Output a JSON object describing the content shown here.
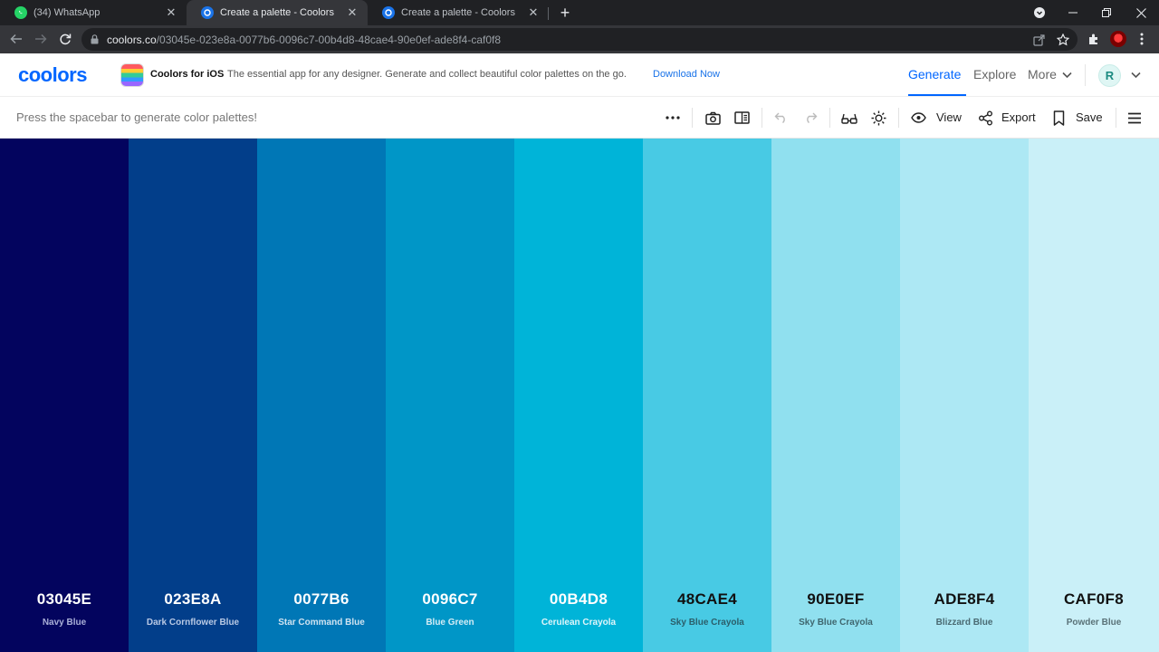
{
  "browser": {
    "tabs": [
      {
        "title": "(34) WhatsApp",
        "active": false
      },
      {
        "title": "Create a palette - Coolors",
        "active": true
      },
      {
        "title": "Create a palette - Coolors",
        "active": false
      }
    ],
    "url_host": "coolors.co",
    "url_path": "/03045e-023e8a-0077b6-0096c7-00b4d8-48cae4-90e0ef-ade8f4-caf0f8"
  },
  "header": {
    "logo": "coolors",
    "ios_title": "Coolors for iOS",
    "ios_description": "The essential app for any designer. Generate and collect beautiful color palettes on the go.",
    "ios_download": "Download Now",
    "nav": {
      "generate": "Generate",
      "explore": "Explore",
      "more": "More"
    },
    "avatar_initial": "R"
  },
  "toolbar": {
    "hint": "Press the spacebar to generate color palettes!",
    "view": "View",
    "export": "Export",
    "save": "Save"
  },
  "palette": [
    {
      "hex": "03045E",
      "name": "Navy Blue",
      "color": "#03045E",
      "text_color": "#ffffff",
      "name_color": "#aab0d8"
    },
    {
      "hex": "023E8A",
      "name": "Dark Cornflower Blue",
      "color": "#023E8A",
      "text_color": "#ffffff",
      "name_color": "#b9c9e4"
    },
    {
      "hex": "0077B6",
      "name": "Star Command Blue",
      "color": "#0077B6",
      "text_color": "#ffffff",
      "name_color": "#cfe3f1"
    },
    {
      "hex": "0096C7",
      "name": "Blue Green",
      "color": "#0096C7",
      "text_color": "#ffffff",
      "name_color": "#d3ecf5"
    },
    {
      "hex": "00B4D8",
      "name": "Cerulean Crayola",
      "color": "#00B4D8",
      "text_color": "#ffffff",
      "name_color": "#e0f5fa"
    },
    {
      "hex": "48CAE4",
      "name": "Sky Blue Crayola",
      "color": "#48CAE4",
      "text_color": "#111111",
      "name_color": "#2b5e6a"
    },
    {
      "hex": "90E0EF",
      "name": "Sky Blue Crayola",
      "color": "#90E0EF",
      "text_color": "#111111",
      "name_color": "#3f666e"
    },
    {
      "hex": "ADE8F4",
      "name": "Blizzard Blue",
      "color": "#ADE8F4",
      "text_color": "#111111",
      "name_color": "#4a6a72"
    },
    {
      "hex": "CAF0F8",
      "name": "Powder Blue",
      "color": "#CAF0F8",
      "text_color": "#111111",
      "name_color": "#5a7278"
    }
  ]
}
